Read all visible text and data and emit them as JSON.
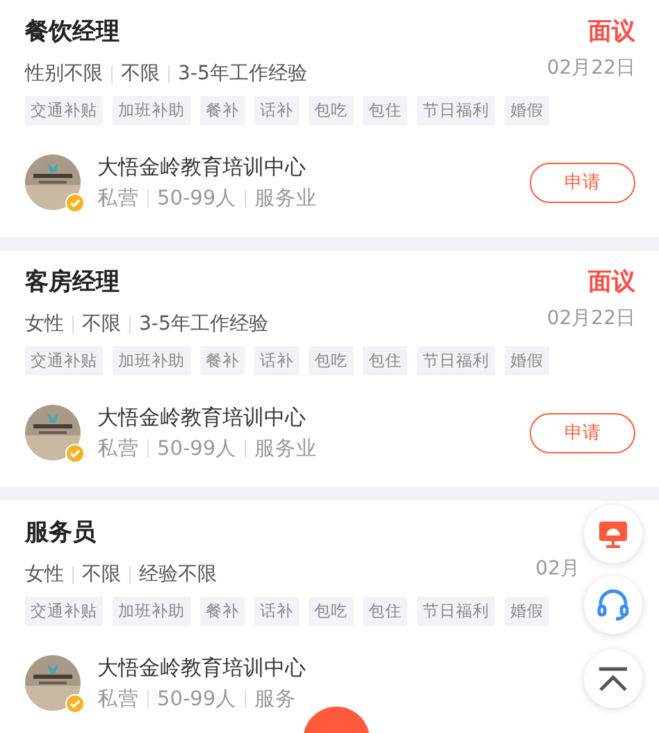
{
  "jobs": [
    {
      "title": "餐饮经理",
      "salary": "面议",
      "requirements": [
        "性别不限",
        "不限",
        "3-5年工作经验"
      ],
      "date": "02月22日",
      "benefits": [
        "交通补贴",
        "加班补助",
        "餐补",
        "话补",
        "包吃",
        "包住",
        "节日福利",
        "婚假"
      ],
      "company": {
        "name": "大悟金岭教育培训中心",
        "verified": true,
        "info": [
          "私营",
          "50-99人",
          "服务业"
        ]
      },
      "apply": "申请"
    },
    {
      "title": "客房经理",
      "salary": "面议",
      "requirements": [
        "女性",
        "不限",
        "3-5年工作经验"
      ],
      "date": "02月22日",
      "benefits": [
        "交通补贴",
        "加班补助",
        "餐补",
        "话补",
        "包吃",
        "包住",
        "节日福利",
        "婚假"
      ],
      "company": {
        "name": "大悟金岭教育培训中心",
        "verified": true,
        "info": [
          "私营",
          "50-99人",
          "服务业"
        ]
      },
      "apply": "申请"
    },
    {
      "title": "服务员",
      "requirements": [
        "女性",
        "不限",
        "经验不限"
      ],
      "date": "02月",
      "benefits": [
        "交通补贴",
        "加班补助",
        "餐补",
        "话补",
        "包吃",
        "包住",
        "节日福利",
        "婚假"
      ],
      "company": {
        "name": "大悟金岭教育培训中心",
        "verified": true,
        "info": [
          "私营",
          "50-99人",
          "服务"
        ]
      }
    }
  ]
}
